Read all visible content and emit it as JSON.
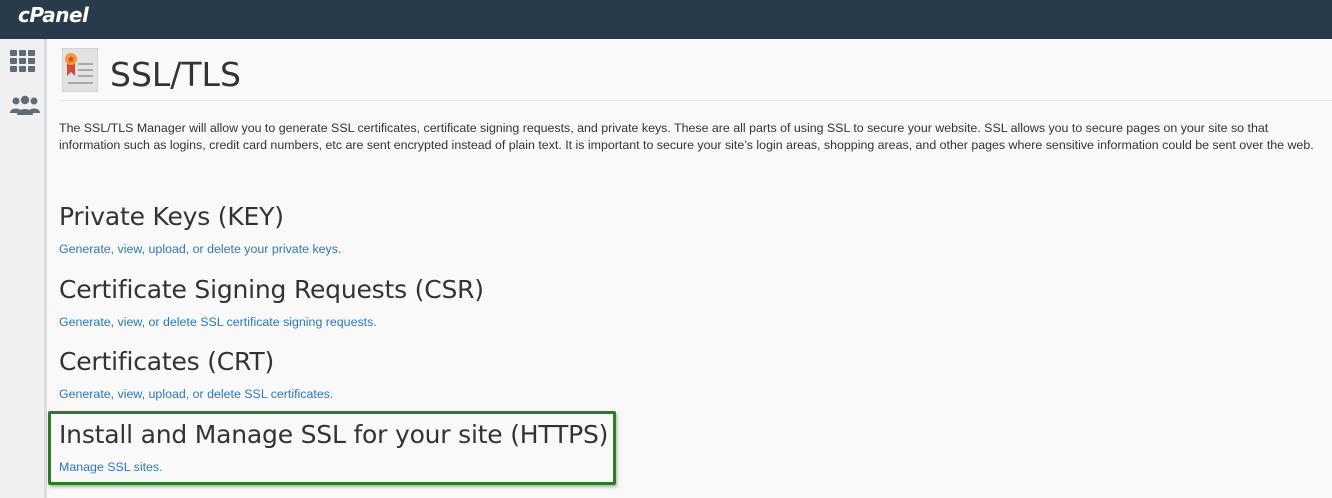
{
  "app": {
    "logo_text": "cPanel"
  },
  "sidebar": {
    "items": [
      {
        "icon": "grid-icon",
        "label": ""
      },
      {
        "icon": "users-icon",
        "label": ""
      }
    ]
  },
  "page": {
    "title": "SSL/TLS",
    "intro": "The SSL/TLS Manager will allow you to generate SSL certificates, certificate signing requests, and private keys. These are all parts of using SSL to secure your website. SSL allows you to secure pages on your site so that information such as logins, credit card numbers, etc are sent encrypted instead of plain text. It is important to secure your site’s login areas, shopping areas, and other pages where sensitive information could be sent over the web."
  },
  "sections": [
    {
      "heading": "Private Keys (KEY)",
      "link": "Generate, view, upload, or delete your private keys."
    },
    {
      "heading": "Certificate Signing Requests (CSR)",
      "link": "Generate, view, or delete SSL certificate signing requests."
    },
    {
      "heading": "Certificates (CRT)",
      "link": "Generate, view, upload, or delete SSL certificates."
    },
    {
      "heading": "Install and Manage SSL for your site (HTTPS)",
      "link": "Manage SSL sites."
    }
  ],
  "colors": {
    "topbar": "#293a4a",
    "link": "#2f78b7",
    "highlight_border": "#2a7a2a"
  }
}
